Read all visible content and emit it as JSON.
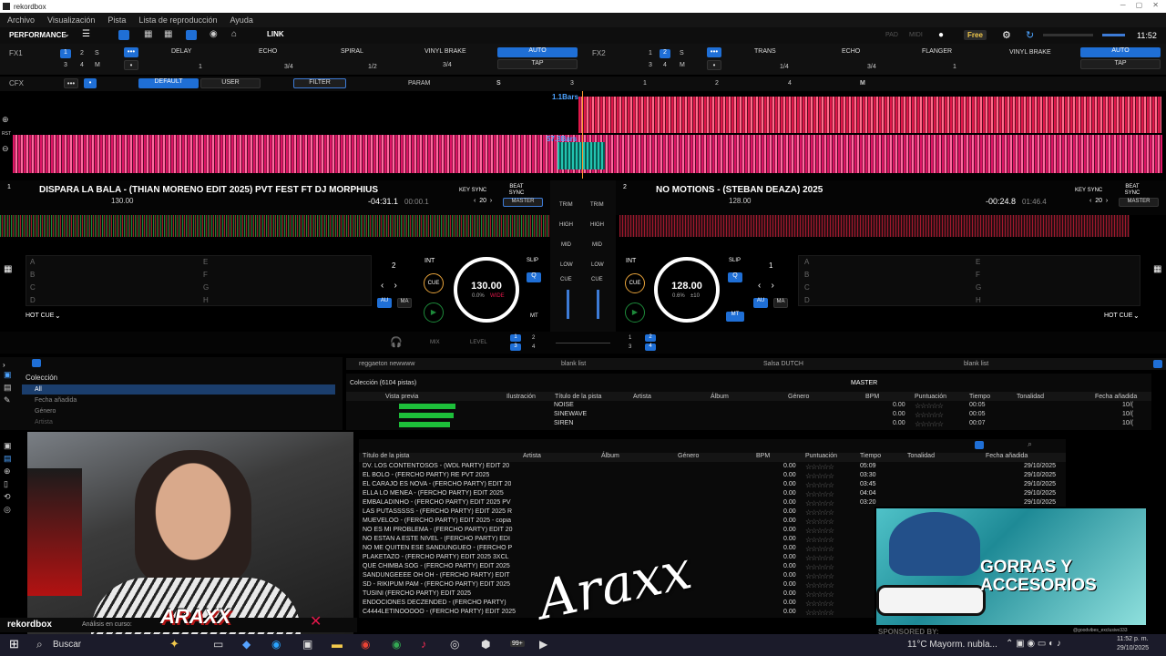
{
  "app": {
    "title": "rekordbox"
  },
  "menu": [
    "Archivo",
    "Visualización",
    "Pista",
    "Lista de reproducción",
    "Ayuda"
  ],
  "top": {
    "mode": "PERFORMANCE",
    "link": "LINK",
    "pad1": "PAD",
    "midi": "MIDI",
    "plan": "Free",
    "time": "11:52"
  },
  "fx1": {
    "label": "FX1",
    "slots": [
      "DELAY",
      "ECHO",
      "SPIRAL"
    ],
    "beats": [
      "1",
      "3/4",
      "1/2"
    ],
    "brake": "VINYL BRAKE",
    "brake_beat": "3/4",
    "auto": "AUTO",
    "tap": "TAP"
  },
  "fx2": {
    "label": "FX2",
    "slots": [
      "TRANS",
      "ECHO",
      "FLANGER"
    ],
    "beats": [
      "1/4",
      "3/4",
      "1"
    ],
    "brake": "VINYL BRAKE",
    "auto": "AUTO",
    "tap": "TAP"
  },
  "cfx": {
    "label": "CFX",
    "default": "DEFAULT",
    "user": "USER",
    "filter": "FILTER",
    "param": "PARAM",
    "s": "S",
    "m": "M",
    "ticks": [
      "3",
      "1",
      "2",
      "4"
    ]
  },
  "wave": {
    "bars1": "1.1Bars",
    "bars2": "57.3Bars",
    "rst": "RST"
  },
  "deck1": {
    "num": "1",
    "title": "DISPARA LA BALA - (THIAN MORENO EDIT 2025) PVT FEST FT DJ MORPHIUS",
    "bpm_small": "130.00",
    "remaining": "-04:31.1",
    "elapsed": "00:00.1",
    "keysync": "KEY SYNC",
    "beatsync": "BEAT SYNC",
    "master": "MASTER",
    "loop": "2",
    "bpm": "130.00",
    "pitch": "0.0%",
    "range": "WIDE",
    "hotcue": "HOT CUE",
    "cue": "CUE",
    "slip": "SLIP",
    "q": "Q",
    "int": "INT",
    "au": "AU",
    "ma": "MA",
    "mt": "MT",
    "pads": [
      "A",
      "B",
      "C",
      "D"
    ],
    "pads2": [
      "E",
      "F",
      "G",
      "H"
    ]
  },
  "deck2": {
    "num": "2",
    "title": "NO MOTIONS - (STEBAN DEAZA) 2025",
    "bpm_small": "128.00",
    "remaining": "-00:24.8",
    "elapsed": "01:46.4",
    "keysync": "KEY SYNC",
    "beatsync": "BEAT SYNC",
    "master": "MASTER",
    "loop": "1",
    "bpm": "128.00",
    "pitch": "0.6%",
    "range": "±10",
    "hotcue": "HOT CUE",
    "cue": "CUE",
    "slip": "SLIP",
    "q": "Q",
    "int": "INT",
    "au": "AU",
    "ma": "MA",
    "mt": "MT",
    "pads": [
      "A",
      "B",
      "C",
      "D"
    ],
    "pads2": [
      "E",
      "F",
      "G",
      "H"
    ]
  },
  "mixer": {
    "trim": "TRIM",
    "high": "HIGH",
    "mid": "MID",
    "low": "LOW",
    "cue": "CUE",
    "mix": "MIX",
    "level": "LEVEL"
  },
  "tree": {
    "collection": "Colección",
    "items": [
      "All",
      "Fecha añadida",
      "Género",
      "Artista"
    ]
  },
  "tabs": [
    "reggaeton newwww",
    "blank list",
    "Salsa DUTCH",
    "blank list"
  ],
  "coll": {
    "title": "Colección (6104 pistas)",
    "master": "MASTER",
    "cols": [
      "Vista previa",
      "Ilustración",
      "Título de la pista",
      "Artista",
      "Álbum",
      "Género",
      "BPM",
      "Puntuación",
      "Tiempo",
      "Tonalidad",
      "Fecha añadida"
    ],
    "rows": [
      {
        "t": "NOISE",
        "bpm": "0.00",
        "time": "00:05",
        "date": "10/("
      },
      {
        "t": "SINEWAVE",
        "bpm": "0.00",
        "time": "00:05",
        "date": "10/("
      },
      {
        "t": "SIREN",
        "bpm": "0.00",
        "time": "00:07",
        "date": "10/("
      }
    ]
  },
  "list": {
    "cols": [
      "Título de la pista",
      "Artista",
      "Álbum",
      "Género",
      "BPM",
      "Puntuación",
      "Tiempo",
      "Tonalidad",
      "Fecha añadida"
    ],
    "rows": [
      {
        "t": "DV. LOS CONTENTOSOS - (WDL PARTY) EDIT 20",
        "bpm": "0.00",
        "time": "05:09",
        "date": "29/10/2025"
      },
      {
        "t": "EL BOLO - (FERCHO PARTY) RE PVT 2025",
        "bpm": "0.00",
        "time": "03:30",
        "date": "29/10/2025"
      },
      {
        "t": "EL CARAJO ES NOVA - (FERCHO PARTY) EDIT 20",
        "bpm": "0.00",
        "time": "03:45",
        "date": "29/10/2025"
      },
      {
        "t": "ELLA LO MENEA - (FERCHO PARTY) EDIT 2025",
        "bpm": "0.00",
        "time": "04:04",
        "date": "29/10/2025"
      },
      {
        "t": "EMBALADINHO - (FERCHO PARTY) EDIT 2025 PV",
        "bpm": "0.00",
        "time": "03:20",
        "date": "29/10/2025"
      },
      {
        "t": "LAS PUTASSSSS - (FERCHO PARTY) EDIT 2025 R",
        "bpm": "0.00",
        "time": "",
        "date": ""
      },
      {
        "t": "MUEVELOO - (FERCHO PARTY) EDIT 2025 - copia",
        "bpm": "0.00",
        "time": "",
        "date": ""
      },
      {
        "t": "NO ES MI PROBLEMA - (FERCHO PARTY) EDIT 20",
        "bpm": "0.00",
        "time": "",
        "date": ""
      },
      {
        "t": "NO ESTAN A ESTE NIVEL - (FERCHO PARTY) EDI",
        "bpm": "0.00",
        "time": "",
        "date": ""
      },
      {
        "t": "NO ME QUITEN ESE SANDUNGUEO - (FERCHO P",
        "bpm": "0.00",
        "time": "",
        "date": ""
      },
      {
        "t": "PLAKETAZO - (FERCHO PARTY) EDIT 2025 3XCL",
        "bpm": "0.00",
        "time": "",
        "date": ""
      },
      {
        "t": "QUE CHIMBA SOG - (FERCHO PARTY) EDIT 2025",
        "bpm": "0.00",
        "time": "",
        "date": ""
      },
      {
        "t": "SANDUNGEEEE OH OH - (FERCHO PARTY) EDIT",
        "bpm": "0.00",
        "time": "",
        "date": ""
      },
      {
        "t": "SD - RIKIPUM PAM - (FERCHO PARTY) EDIT 2025",
        "bpm": "0.00",
        "time": "",
        "date": ""
      },
      {
        "t": "TUSINI (FERCHO PARTY) EDIT 2025",
        "bpm": "0.00",
        "time": "",
        "date": ""
      },
      {
        "t": "ENDOCIONES DECZENDED - (FERCHO PARTY)",
        "bpm": "0.00",
        "time": "",
        "date": ""
      },
      {
        "t": "C4444LETIÑOOOOO - (FERCHO PARTY) EDIT 2025",
        "bpm": "0.00",
        "time": "",
        "date": ""
      }
    ]
  },
  "status": {
    "brand": "rekordbox",
    "analysis": "Análisis en curso:"
  },
  "overlay": {
    "logo": "ARAXX",
    "signature": "Araxx",
    "ad_text1": "GORRAS Y",
    "ad_text2": "ACCESORIOS",
    "sponsored": "SPONSORED BY:",
    "handle": "@goodvibes_exclusive333"
  },
  "taskbar": {
    "search": "Buscar",
    "badge": "99+",
    "weather": "11°C  Mayorm. nubla...",
    "clock": "11:52 p. m.",
    "date": "29/10/2025"
  }
}
